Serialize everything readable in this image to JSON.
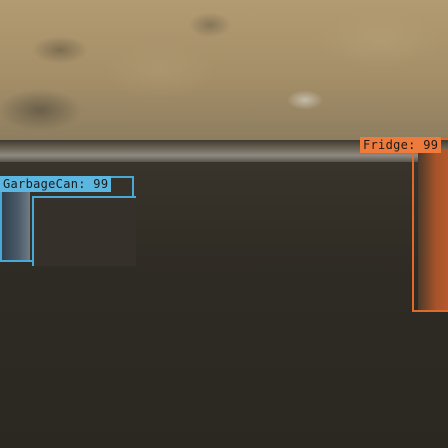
{
  "detections": [
    {
      "id": "garbage",
      "label": "GarbageCan: 99",
      "color": "#49a9d6"
    },
    {
      "id": "fridge",
      "label": "Fridge: 99",
      "color": "#e06a2c"
    }
  ]
}
